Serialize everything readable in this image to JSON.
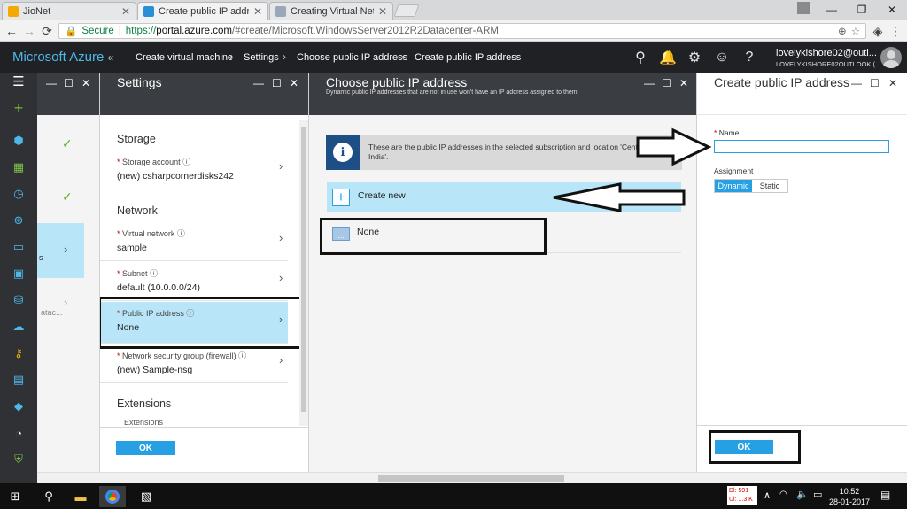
{
  "browser": {
    "tabs": [
      {
        "title": "JioNet"
      },
      {
        "title": "Create public IP address"
      },
      {
        "title": "Creating Virtual Network"
      }
    ],
    "secure_label": "Secure",
    "url_scheme": "https://",
    "url_host": "portal.azure.com",
    "url_path": "/#create/Microsoft.WindowsServer2012R2Datacenter-ARM"
  },
  "azure": {
    "brand": "Microsoft Azure",
    "breadcrumb": [
      "Create virtual machine",
      "Settings",
      "Choose public IP address",
      "Create public IP address"
    ],
    "user_name": "lovelykishore02@outl...",
    "user_email": "LOVELYKISHORE02OUTLOOK (..."
  },
  "left_blade": {
    "item_text_1": "s",
    "item_text_2": "atac..."
  },
  "settings": {
    "title": "Settings",
    "section_storage": "Storage",
    "storage_account_label": "Storage account",
    "storage_account_value": "(new) csharpcornerdisks242",
    "section_network": "Network",
    "vnet_label": "Virtual network",
    "vnet_value": "sample",
    "subnet_label": "Subnet",
    "subnet_value": "default (10.0.0.0/24)",
    "pip_label": "Public IP address",
    "pip_value": "None",
    "nsg_label": "Network security group (firewall)",
    "nsg_value": "(new) Sample-nsg",
    "section_extensions": "Extensions",
    "extensions_label": "Extensions",
    "ok": "OK"
  },
  "choose": {
    "title": "Choose public IP address",
    "subtitle": "Dynamic public IP addresses that are not in use won't have an IP address assigned to them.",
    "info": "These are the public IP addresses in the selected subscription and location 'Central India'.",
    "create_new": "Create new",
    "none": "None"
  },
  "create": {
    "title": "Create public IP address",
    "name_label": "Name",
    "name_value": "",
    "assignment_label": "Assignment",
    "dynamic": "Dynamic",
    "static": "Static",
    "ok": "OK"
  },
  "taskbar": {
    "net_dl": "Dl: 591",
    "net_ul": "Ul: 1.3 K",
    "time": "10:52",
    "date": "28-01-2017"
  },
  "colors": {
    "azure_blue": "#27a0e3",
    "selected_row": "#b8e5f7",
    "brand_blue": "#4fb7e8",
    "dark_bar": "#1f2124"
  }
}
